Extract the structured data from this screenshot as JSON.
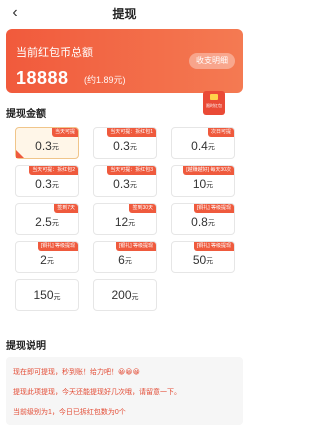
{
  "header": {
    "title": "提现",
    "back_icon": "chevron-left-icon"
  },
  "balance": {
    "label": "当前红包币总额",
    "amount": "18888",
    "sub": "(约1.89元)",
    "detail_button": "收支明细"
  },
  "float_badge": {
    "icon": "red-envelope-icon",
    "label": "限时红包"
  },
  "withdraw": {
    "section_title": "提现金额",
    "options": [
      {
        "amount": "0.3",
        "unit": "元",
        "tag": "当天可提",
        "selected": true
      },
      {
        "amount": "0.3",
        "unit": "元",
        "tag": "当天可提：拆红包1",
        "selected": false
      },
      {
        "amount": "0.4",
        "unit": "元",
        "tag": "次日可提",
        "selected": false
      },
      {
        "amount": "0.3",
        "unit": "元",
        "tag": "当天可提：拆红包2",
        "selected": false
      },
      {
        "amount": "0.3",
        "unit": "元",
        "tag": "当天可提：拆红包3",
        "selected": false
      },
      {
        "amount": "10",
        "unit": "元",
        "tag": "[越赚越好] 每天30次",
        "selected": false
      },
      {
        "amount": "2.5",
        "unit": "元",
        "tag": "签到7天",
        "selected": false
      },
      {
        "amount": "12",
        "unit": "元",
        "tag": "签到30天",
        "selected": false
      },
      {
        "amount": "0.8",
        "unit": "元",
        "tag": "[铜礼] 等级提现",
        "selected": false
      },
      {
        "amount": "2",
        "unit": "元",
        "tag": "[铜礼] 等级提现",
        "selected": false
      },
      {
        "amount": "6",
        "unit": "元",
        "tag": "[银礼] 等级提现",
        "selected": false
      },
      {
        "amount": "50",
        "unit": "元",
        "tag": "[铜礼] 等级提现",
        "selected": false
      },
      {
        "amount": "150",
        "unit": "元",
        "tag": "",
        "selected": false
      },
      {
        "amount": "200",
        "unit": "元",
        "tag": "",
        "selected": false
      }
    ]
  },
  "instructions": {
    "title": "提现说明",
    "lines": [
      "现在即可提现，秒到账！给力吧！😀😀😀",
      "提现此项提现，今天还能提现好几次哦，请留意一下。",
      "当前级别为1，今日已拆红包数为0个"
    ]
  },
  "colors": {
    "accent": "#ef5a3d",
    "banner_start": "#f15a3c",
    "banner_end": "#f47a52",
    "selected_bg": "#fff6e8"
  }
}
